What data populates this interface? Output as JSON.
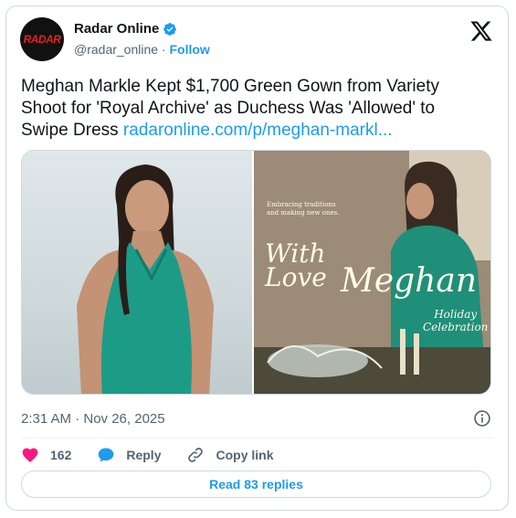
{
  "author": {
    "name": "Radar Online",
    "handle": "@radar_online",
    "separator": " · ",
    "follow_label": "Follow",
    "avatar_text": "RADAR"
  },
  "tweet": {
    "text": "Meghan Markle Kept $1,700 Green Gown from Variety Shoot for 'Royal Archive' as Duchess Was 'Allowed' to Swipe Dress ",
    "link": "radaronline.com/p/meghan-markl..."
  },
  "media": {
    "overlay_small": "Embracing traditions and making new ones.",
    "overlay_big_1": "With",
    "overlay_big_2": "Love",
    "overlay_script": "Meghan",
    "overlay_sub_1": "Holiday",
    "overlay_sub_2": "Celebration"
  },
  "timestamp": "2:31 AM · Nov 26, 2025",
  "actions": {
    "likes": "162",
    "reply_label": "Reply",
    "copy_link_label": "Copy link"
  },
  "read_replies_label": "Read 83 replies",
  "colors": {
    "accent": "#1d9bf0",
    "like": "#f91880",
    "text": "#0f1419",
    "muted": "#536471"
  }
}
